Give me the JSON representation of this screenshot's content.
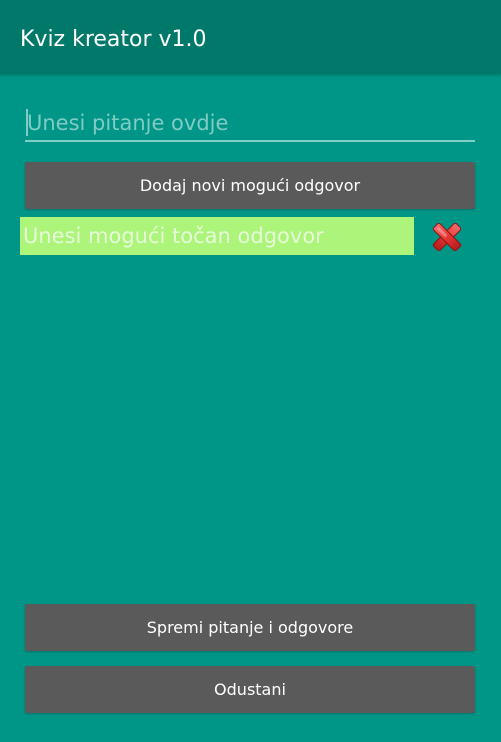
{
  "app_bar": {
    "title": "Kviz kreator v1.0"
  },
  "question": {
    "placeholder": "Unesi pitanje ovdje",
    "value": ""
  },
  "add_answer_button": {
    "label": "Dodaj novi mogući odgovor"
  },
  "answers": [
    {
      "placeholder": "Unesi mogući točan odgovor",
      "value": "",
      "delete_icon": "red-x-icon"
    }
  ],
  "save_button": {
    "label": "Spremi pitanje i odgovore"
  },
  "cancel_button": {
    "label": "Odustani"
  },
  "colors": {
    "background": "#009687",
    "app_bar": "#00796b",
    "button": "#5a5a5a",
    "answer_field": "#acf47a",
    "delete_icon": "#e53935"
  }
}
